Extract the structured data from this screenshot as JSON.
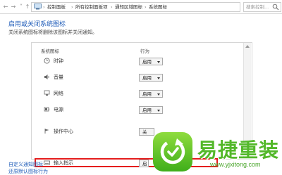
{
  "address_bar": {
    "back_icon": "back-arrow-icon",
    "forward_icon": "forward-arrow-icon",
    "crumbs": [
      "控制面板",
      "所有控制面板项",
      "通知区域图标",
      "系统图标"
    ],
    "search_placeholder": "搜索控制..."
  },
  "page": {
    "title": "启用或关闭系统图标",
    "subtitle": "关闭系统图标将删除该图标并关闭通知。"
  },
  "table": {
    "col_icon": "系统图标",
    "col_behavior": "行为",
    "rows": [
      {
        "label": "时钟",
        "value": "启用",
        "icon": "clock-icon"
      },
      {
        "label": "音量",
        "value": "启用",
        "icon": "volume-icon"
      },
      {
        "label": "网络",
        "value": "启用",
        "icon": "network-icon"
      },
      {
        "label": "电源",
        "value": "启用",
        "icon": "power-icon"
      },
      {
        "label": "操作中心",
        "value": "关",
        "icon": "action-center-icon"
      },
      {
        "label": "输入指示",
        "value": "启",
        "icon": "input-indicator-icon"
      }
    ]
  },
  "links": {
    "customize": "自定义通知图标",
    "restore": "还原默认图标行为"
  },
  "watermark": {
    "brand": "易捷重装",
    "url": "www.yjxitong.com",
    "colors": {
      "green": "#53b82a",
      "badge_top": "#8fdc3e",
      "badge_bottom": "#3fae1a"
    }
  },
  "colors": {
    "link_blue": "#1e5bb8",
    "highlight_red": "#e41d1d"
  }
}
